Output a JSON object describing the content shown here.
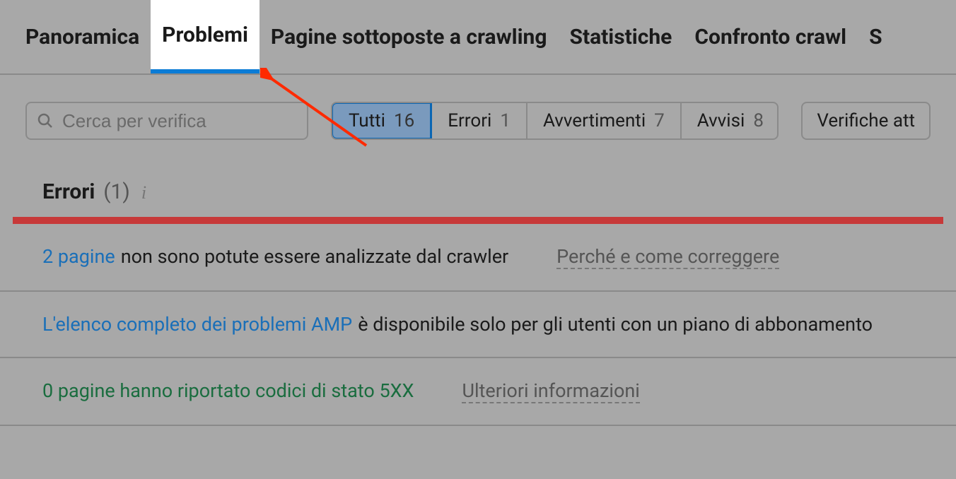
{
  "nav": {
    "tabs": [
      {
        "label": "Panoramica",
        "active": false
      },
      {
        "label": "Problemi",
        "active": true
      },
      {
        "label": "Pagine sottoposte a crawling",
        "active": false
      },
      {
        "label": "Statistiche",
        "active": false
      },
      {
        "label": "Confronto crawl",
        "active": false
      },
      {
        "label": "S",
        "active": false
      }
    ]
  },
  "search": {
    "placeholder": "Cerca per verifica"
  },
  "filters": [
    {
      "label": "Tutti",
      "count": "16",
      "selected": true
    },
    {
      "label": "Errori",
      "count": "1",
      "selected": false
    },
    {
      "label": "Avvertimenti",
      "count": "7",
      "selected": false
    },
    {
      "label": "Avvisi",
      "count": "8",
      "selected": false
    }
  ],
  "verifications_label": "Verifiche att",
  "section": {
    "title": "Errori",
    "count": "(1)"
  },
  "issues": [
    {
      "link_text": "2 pagine",
      "rest_text": " non sono potute essere analizzate dal crawler",
      "helper": "Perché e come correggere",
      "style": "blue-link"
    },
    {
      "link_text": "L'elenco completo dei problemi AMP",
      "rest_text": " è disponibile solo per gli utenti con un piano di abbonamento",
      "helper": "",
      "style": "blue-link"
    },
    {
      "link_text": "0 pagine hanno riportato codici di stato 5XX",
      "rest_text": "",
      "helper": "Ulteriori informazioni",
      "style": "green"
    }
  ]
}
